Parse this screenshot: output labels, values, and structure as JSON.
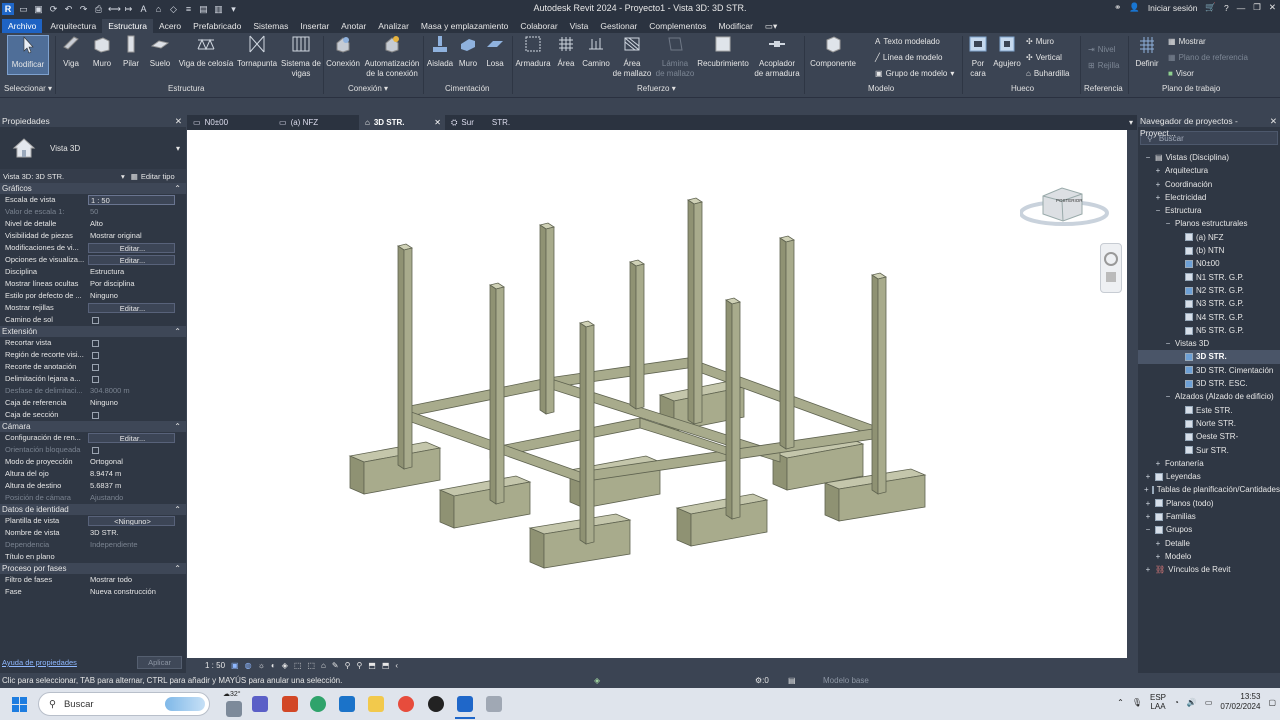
{
  "titlebar": {
    "app_title": "Autodesk Revit 2024 - Proyecto1 - Vista 3D: 3D STR.",
    "login": "Iniciar sesión",
    "window_buttons": [
      "—",
      "❐",
      "✕"
    ]
  },
  "menu": {
    "tabs": [
      "Archivo",
      "Arquitectura",
      "Estructura",
      "Acero",
      "Prefabricado",
      "Sistemas",
      "Insertar",
      "Anotar",
      "Analizar",
      "Masa y emplazamiento",
      "Colaborar",
      "Vista",
      "Gestionar",
      "Complementos",
      "Modificar"
    ],
    "active": "Estructura"
  },
  "ribbon": {
    "buttons": [
      {
        "label": "Modificar"
      },
      {
        "label": "Viga"
      },
      {
        "label": "Muro"
      },
      {
        "label": "Pilar"
      },
      {
        "label": "Suelo"
      },
      {
        "label": "Viga de celosía"
      },
      {
        "label": "Tornapunta"
      },
      {
        "label": "Sistema de vigas",
        "label2": "vigas"
      },
      {
        "label": "Conexión"
      },
      {
        "label": "Automatización",
        "label2": "de la conexión"
      },
      {
        "label": "Aislada"
      },
      {
        "label": "Muro"
      },
      {
        "label": "Losa"
      },
      {
        "label": "Armadura"
      },
      {
        "label": "Área"
      },
      {
        "label": "Camino"
      },
      {
        "label": "Área",
        "label2": "de mallazo"
      },
      {
        "label": "Lámina",
        "label2": "de mallazo"
      },
      {
        "label": "Recubrimiento"
      },
      {
        "label": "Acoplador",
        "label2": "de armadura"
      },
      {
        "label": "Componente"
      },
      {
        "label": "Por",
        "label2": "cara"
      },
      {
        "label": "Agujero"
      },
      {
        "label": "Definir"
      }
    ],
    "small": {
      "texto_modelado": "Texto modelado",
      "linea_modelo": "Línea de modelo",
      "grupo_modelo": "Grupo de modelo",
      "muro": "Muro",
      "vertical": "Vertical",
      "buhardilla": "Buhardilla",
      "nivel": "Nivel",
      "rejilla": "Rejilla",
      "mostrar": "Mostrar",
      "plano_ref": "Plano de referencia",
      "visor": "Visor"
    },
    "panels": [
      "Seleccionar",
      "Estructura",
      "Conexión",
      "Cimentación",
      "Refuerzo",
      "Modelo",
      "Hueco",
      "Referencia",
      "Plano de trabajo"
    ]
  },
  "properties": {
    "title": "Propiedades",
    "type_name": "Vista 3D",
    "selector": "Vista 3D: 3D STR.",
    "edit_type": "Editar tipo",
    "sections": [
      {
        "name": "Gráficos",
        "rows": [
          {
            "k": "Escala de vista",
            "v": "1 : 50",
            "kind": "input"
          },
          {
            "k": "Valor de escala    1:",
            "v": "50",
            "kind": "dis"
          },
          {
            "k": "Nivel de detalle",
            "v": "Alto"
          },
          {
            "k": "Visibilidad de piezas",
            "v": "Mostrar original"
          },
          {
            "k": "Modificaciones de vi...",
            "v": "Editar...",
            "kind": "btn"
          },
          {
            "k": "Opciones de visualiza...",
            "v": "Editar...",
            "kind": "btn"
          },
          {
            "k": "Disciplina",
            "v": "Estructura"
          },
          {
            "k": "Mostrar líneas ocultas",
            "v": "Por disciplina"
          },
          {
            "k": "Estilo por defecto de ...",
            "v": "Ninguno"
          },
          {
            "k": "Mostrar rejillas",
            "v": "Editar...",
            "kind": "btn"
          },
          {
            "k": "Camino de sol",
            "v": "",
            "kind": "cb"
          }
        ]
      },
      {
        "name": "Extensión",
        "rows": [
          {
            "k": "Recortar vista",
            "v": "",
            "kind": "cb"
          },
          {
            "k": "Región de recorte visi...",
            "v": "",
            "kind": "cb"
          },
          {
            "k": "Recorte de anotación",
            "v": "",
            "kind": "cb"
          },
          {
            "k": "Delimitación lejana a...",
            "v": "",
            "kind": "cb"
          },
          {
            "k": "Desfase de delimitaci...",
            "v": "304.8000 m",
            "kind": "dis"
          },
          {
            "k": "Caja de referencia",
            "v": "Ninguno"
          },
          {
            "k": "Caja de sección",
            "v": "",
            "kind": "cb"
          }
        ]
      },
      {
        "name": "Cámara",
        "rows": [
          {
            "k": "Configuración de ren...",
            "v": "Editar...",
            "kind": "btn"
          },
          {
            "k": "Orientación bloqueada",
            "v": "",
            "kind": "cbdis"
          },
          {
            "k": "Modo de proyección",
            "v": "Ortogonal"
          },
          {
            "k": "Altura del ojo",
            "v": "8.9474 m"
          },
          {
            "k": "Altura de destino",
            "v": "5.6837 m"
          },
          {
            "k": "Posición de cámara",
            "v": "Ajustando",
            "kind": "dis"
          }
        ]
      },
      {
        "name": "Datos de identidad",
        "rows": [
          {
            "k": "Plantilla de vista",
            "v": "<Ninguno>",
            "kind": "btn"
          },
          {
            "k": "Nombre de vista",
            "v": "3D STR."
          },
          {
            "k": "Dependencia",
            "v": "Independiente",
            "kind": "dis"
          },
          {
            "k": "Título en plano",
            "v": ""
          }
        ]
      },
      {
        "name": "Proceso por fases",
        "rows": [
          {
            "k": "Filtro de fases",
            "v": "Mostrar todo"
          },
          {
            "k": "Fase",
            "v": "Nueva construcción"
          }
        ]
      }
    ],
    "help_link": "Ayuda de propiedades",
    "apply": "Aplicar"
  },
  "view_tabs": [
    {
      "label": "N0±00"
    },
    {
      "label": "(a) NFZ"
    },
    {
      "label": "3D STR."
    },
    {
      "label": "Sur",
      "label2": "STR."
    }
  ],
  "viewcube_label": "POSTERIOR",
  "viewbar": {
    "scale": "1 : 50"
  },
  "navigator": {
    "title": "Navegador de proyectos - Proyect...",
    "search_placeholder": "Buscar",
    "items": [
      {
        "t": "Vistas (Disciplina)",
        "lvl": 0,
        "ex": "−",
        "ic": "views"
      },
      {
        "t": "Arquitectura",
        "lvl": 1,
        "ex": "+"
      },
      {
        "t": "Coordinación",
        "lvl": 1,
        "ex": "+"
      },
      {
        "t": "Electricidad",
        "lvl": 1,
        "ex": "+"
      },
      {
        "t": "Estructura",
        "lvl": 1,
        "ex": "−"
      },
      {
        "t": "Planos estructurales",
        "lvl": 2,
        "ex": "−"
      },
      {
        "t": "(a) NFZ",
        "lvl": 3,
        "ic": "sq"
      },
      {
        "t": "(b) NTN",
        "lvl": 3,
        "ic": "sq"
      },
      {
        "t": "N0±00",
        "lvl": 3,
        "ic": "sqb"
      },
      {
        "t": "N1 STR. G.P.",
        "lvl": 3,
        "ic": "sq"
      },
      {
        "t": "N2 STR. G.P.",
        "lvl": 3,
        "ic": "sqb"
      },
      {
        "t": "N3 STR. G.P.",
        "lvl": 3,
        "ic": "sq"
      },
      {
        "t": "N4 STR. G.P.",
        "lvl": 3,
        "ic": "sq"
      },
      {
        "t": "N5 STR. G.P.",
        "lvl": 3,
        "ic": "sq"
      },
      {
        "t": "Vistas 3D",
        "lvl": 2,
        "ex": "−"
      },
      {
        "t": "3D STR.",
        "lvl": 3,
        "ic": "sqb",
        "sel": true
      },
      {
        "t": "3D STR. Cimentación",
        "lvl": 3,
        "ic": "sqb"
      },
      {
        "t": "3D STR. ESC.",
        "lvl": 3,
        "ic": "sqb"
      },
      {
        "t": "Alzados (Alzado de edificio)",
        "lvl": 2,
        "ex": "−"
      },
      {
        "t": "Este STR.",
        "lvl": 3,
        "ic": "sq"
      },
      {
        "t": "Norte STR.",
        "lvl": 3,
        "ic": "sq"
      },
      {
        "t": "Oeste STR-",
        "lvl": 3,
        "ic": "sq"
      },
      {
        "t": "Sur STR.",
        "lvl": 3,
        "ic": "sq"
      },
      {
        "t": "Fontanería",
        "lvl": 1,
        "ex": "+"
      },
      {
        "t": "Leyendas",
        "lvl": 0,
        "ex": "+",
        "ic": "sq"
      },
      {
        "t": "Tablas de planificación/Cantidades",
        "lvl": 0,
        "ex": "+",
        "ic": "sq"
      },
      {
        "t": "Planos (todo)",
        "lvl": 0,
        "ex": "+",
        "ic": "sq"
      },
      {
        "t": "Familias",
        "lvl": 0,
        "ex": "+",
        "ic": "sq"
      },
      {
        "t": "Grupos",
        "lvl": 0,
        "ex": "−",
        "ic": "sq"
      },
      {
        "t": "Detalle",
        "lvl": 1,
        "ex": "+"
      },
      {
        "t": "Modelo",
        "lvl": 1,
        "ex": "+"
      },
      {
        "t": "Vínculos de Revit",
        "lvl": 0,
        "ex": "+",
        "ic": "link"
      }
    ]
  },
  "status": {
    "text": "Clic para seleccionar, TAB para alternar, CTRL para añadir y MAYÚS para anular una selección.",
    "count1": ":0",
    "model": "Modelo base",
    "count2": ":0"
  },
  "taskbar": {
    "search": "Buscar",
    "temp": "32°",
    "lang1": "ESP",
    "lang2": "LAA",
    "time": "13:53",
    "date": "07/02/2024"
  },
  "colors": {
    "accent": "#1e63c4",
    "concrete": "#a8ab8c",
    "ui_bg": "#3b4453"
  }
}
